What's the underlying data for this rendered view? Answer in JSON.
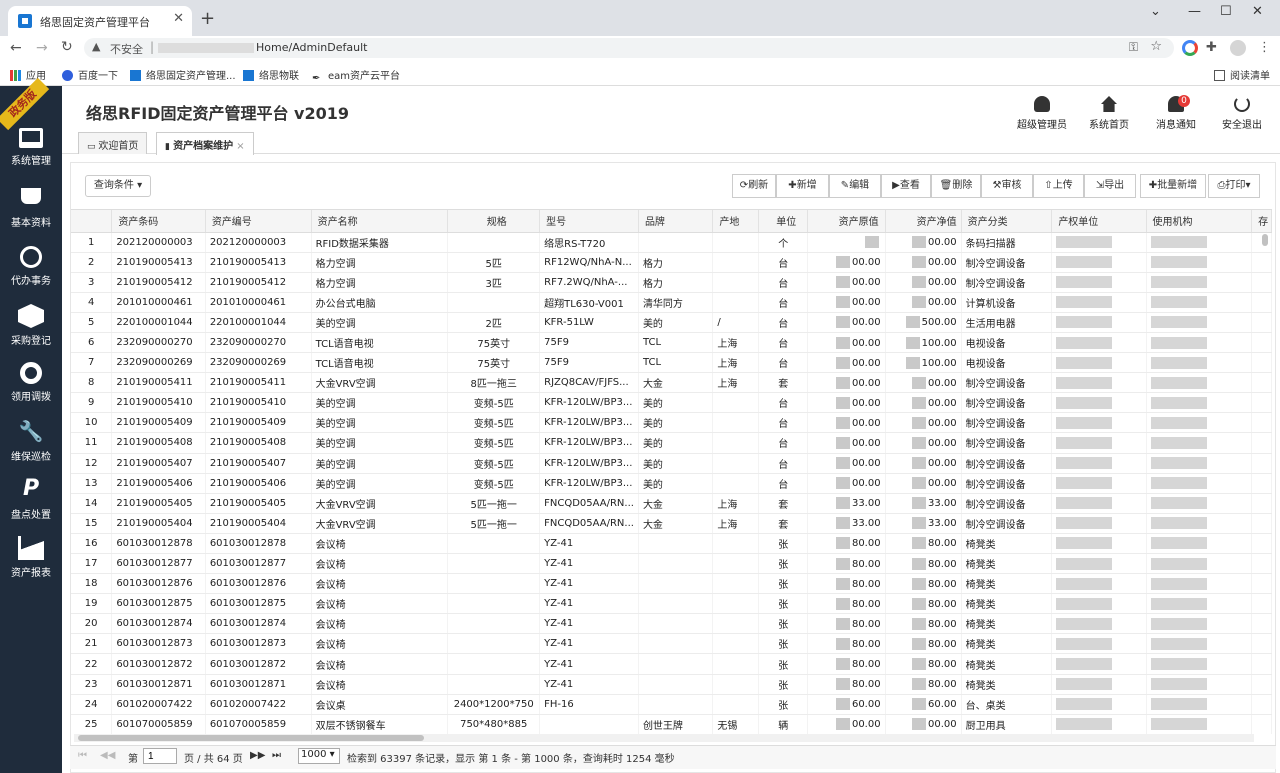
{
  "browser": {
    "tab_title": "络思固定资产管理平台",
    "insecure_label": "不安全",
    "url_path": "Home/AdminDefault",
    "bookmarks": [
      "应用",
      "百度一下",
      "络思固定资产管理...",
      "络思物联",
      "eam资产云平台"
    ],
    "reading_list": "阅读清单"
  },
  "app": {
    "ribbon": "政务版",
    "title": "络思RFID固定资产管理平台 v2019",
    "header_buttons": [
      "超级管理员",
      "系统首页",
      "消息通知",
      "安全退出"
    ],
    "notify_count": "0"
  },
  "sidebar": [
    "系统管理",
    "基本资料",
    "代办事务",
    "采购登记",
    "领用调拨",
    "维保巡检",
    "盘点处置",
    "资产报表"
  ],
  "tabs": [
    "欢迎首页",
    "资产档案维护"
  ],
  "toolbar": {
    "query": "查询条件 ▾",
    "buttons": [
      "刷新",
      "新增",
      "编辑",
      "查看",
      "删除",
      "审核",
      "上传",
      "导出",
      "批量新增",
      "打印▾"
    ]
  },
  "columns": [
    "资产条码",
    "资产编号",
    "资产名称",
    "规格",
    "型号",
    "品牌",
    "产地",
    "单位",
    "资产原值",
    "资产净值",
    "资产分类",
    "产权单位",
    "使用机构",
    "存"
  ],
  "rows": [
    [
      "1",
      "202120000003",
      "202120000003",
      "RFID数据采集器",
      "",
      "络思RS-T720",
      "",
      "",
      "个",
      "",
      "00.00",
      "条码扫描器"
    ],
    [
      "2",
      "210190005413",
      "210190005413",
      "格力空调",
      "5匹",
      "RF12WQ/NhA-N...",
      "格力",
      "",
      "台",
      "00.00",
      "00.00",
      "制冷空调设备"
    ],
    [
      "3",
      "210190005412",
      "210190005412",
      "格力空调",
      "3匹",
      "RF7.2WQ/NhA-...",
      "格力",
      "",
      "台",
      "00.00",
      "00.00",
      "制冷空调设备"
    ],
    [
      "4",
      "201010000461",
      "201010000461",
      "办公台式电脑",
      "",
      "超翔TL630-V001",
      "清华同方",
      "",
      "台",
      "00.00",
      "00.00",
      "计算机设备"
    ],
    [
      "5",
      "220100001044",
      "220100001044",
      "美的空调",
      "2匹",
      "KFR-51LW",
      "美的",
      "/",
      "台",
      "00.00",
      "500.00",
      "生活用电器"
    ],
    [
      "6",
      "232090000270",
      "232090000270",
      "TCL语音电视",
      "75英寸",
      "75F9",
      "TCL",
      "上海",
      "台",
      "00.00",
      "100.00",
      "电视设备"
    ],
    [
      "7",
      "232090000269",
      "232090000269",
      "TCL语音电视",
      "75英寸",
      "75F9",
      "TCL",
      "上海",
      "台",
      "00.00",
      "100.00",
      "电视设备"
    ],
    [
      "8",
      "210190005411",
      "210190005411",
      "大金VRV空调",
      "8匹一拖三",
      "RJZQ8CAV/FJFS...",
      "大金",
      "上海",
      "套",
      "00.00",
      "00.00",
      "制冷空调设备"
    ],
    [
      "9",
      "210190005410",
      "210190005410",
      "美的空调",
      "变频-5匹",
      "KFR-120LW/BP3...",
      "美的",
      "",
      "台",
      "00.00",
      "00.00",
      "制冷空调设备"
    ],
    [
      "10",
      "210190005409",
      "210190005409",
      "美的空调",
      "变频-5匹",
      "KFR-120LW/BP3...",
      "美的",
      "",
      "台",
      "00.00",
      "00.00",
      "制冷空调设备"
    ],
    [
      "11",
      "210190005408",
      "210190005408",
      "美的空调",
      "变频-5匹",
      "KFR-120LW/BP3...",
      "美的",
      "",
      "台",
      "00.00",
      "00.00",
      "制冷空调设备"
    ],
    [
      "12",
      "210190005407",
      "210190005407",
      "美的空调",
      "变频-5匹",
      "KFR-120LW/BP3...",
      "美的",
      "",
      "台",
      "00.00",
      "00.00",
      "制冷空调设备"
    ],
    [
      "13",
      "210190005406",
      "210190005406",
      "美的空调",
      "变频-5匹",
      "KFR-120LW/BP3...",
      "美的",
      "",
      "台",
      "00.00",
      "00.00",
      "制冷空调设备"
    ],
    [
      "14",
      "210190005405",
      "210190005405",
      "大金VRV空调",
      "5匹一拖一",
      "FNCQD05AA/RN...",
      "大金",
      "上海",
      "套",
      "33.00",
      "33.00",
      "制冷空调设备"
    ],
    [
      "15",
      "210190005404",
      "210190005404",
      "大金VRV空调",
      "5匹一拖一",
      "FNCQD05AA/RN...",
      "大金",
      "上海",
      "套",
      "33.00",
      "33.00",
      "制冷空调设备"
    ],
    [
      "16",
      "601030012878",
      "601030012878",
      "会议椅",
      "",
      "YZ-41",
      "",
      "",
      "张",
      "80.00",
      "80.00",
      "椅凳类"
    ],
    [
      "17",
      "601030012877",
      "601030012877",
      "会议椅",
      "",
      "YZ-41",
      "",
      "",
      "张",
      "80.00",
      "80.00",
      "椅凳类"
    ],
    [
      "18",
      "601030012876",
      "601030012876",
      "会议椅",
      "",
      "YZ-41",
      "",
      "",
      "张",
      "80.00",
      "80.00",
      "椅凳类"
    ],
    [
      "19",
      "601030012875",
      "601030012875",
      "会议椅",
      "",
      "YZ-41",
      "",
      "",
      "张",
      "80.00",
      "80.00",
      "椅凳类"
    ],
    [
      "20",
      "601030012874",
      "601030012874",
      "会议椅",
      "",
      "YZ-41",
      "",
      "",
      "张",
      "80.00",
      "80.00",
      "椅凳类"
    ],
    [
      "21",
      "601030012873",
      "601030012873",
      "会议椅",
      "",
      "YZ-41",
      "",
      "",
      "张",
      "80.00",
      "80.00",
      "椅凳类"
    ],
    [
      "22",
      "601030012872",
      "601030012872",
      "会议椅",
      "",
      "YZ-41",
      "",
      "",
      "张",
      "80.00",
      "80.00",
      "椅凳类"
    ],
    [
      "23",
      "601030012871",
      "601030012871",
      "会议椅",
      "",
      "YZ-41",
      "",
      "",
      "张",
      "80.00",
      "80.00",
      "椅凳类"
    ],
    [
      "24",
      "601020007422",
      "601020007422",
      "会议桌",
      "2400*1200*750",
      "FH-16",
      "",
      "",
      "张",
      "60.00",
      "60.00",
      "台、桌类"
    ],
    [
      "25",
      "601070005859",
      "601070005859",
      "双层不锈钢餐车",
      "750*480*885",
      "",
      "创世王牌",
      "无锡",
      "辆",
      "00.00",
      "00.00",
      "厨卫用具"
    ]
  ],
  "pager": {
    "page_prefix": "第",
    "page_value": "1",
    "page_suffix": "页 / 共 64 页",
    "page_size": "1000",
    "summary": "检索到 63397 条记录，显示 第 1 条 - 第 1000 条，查询耗时 1254 毫秒"
  }
}
